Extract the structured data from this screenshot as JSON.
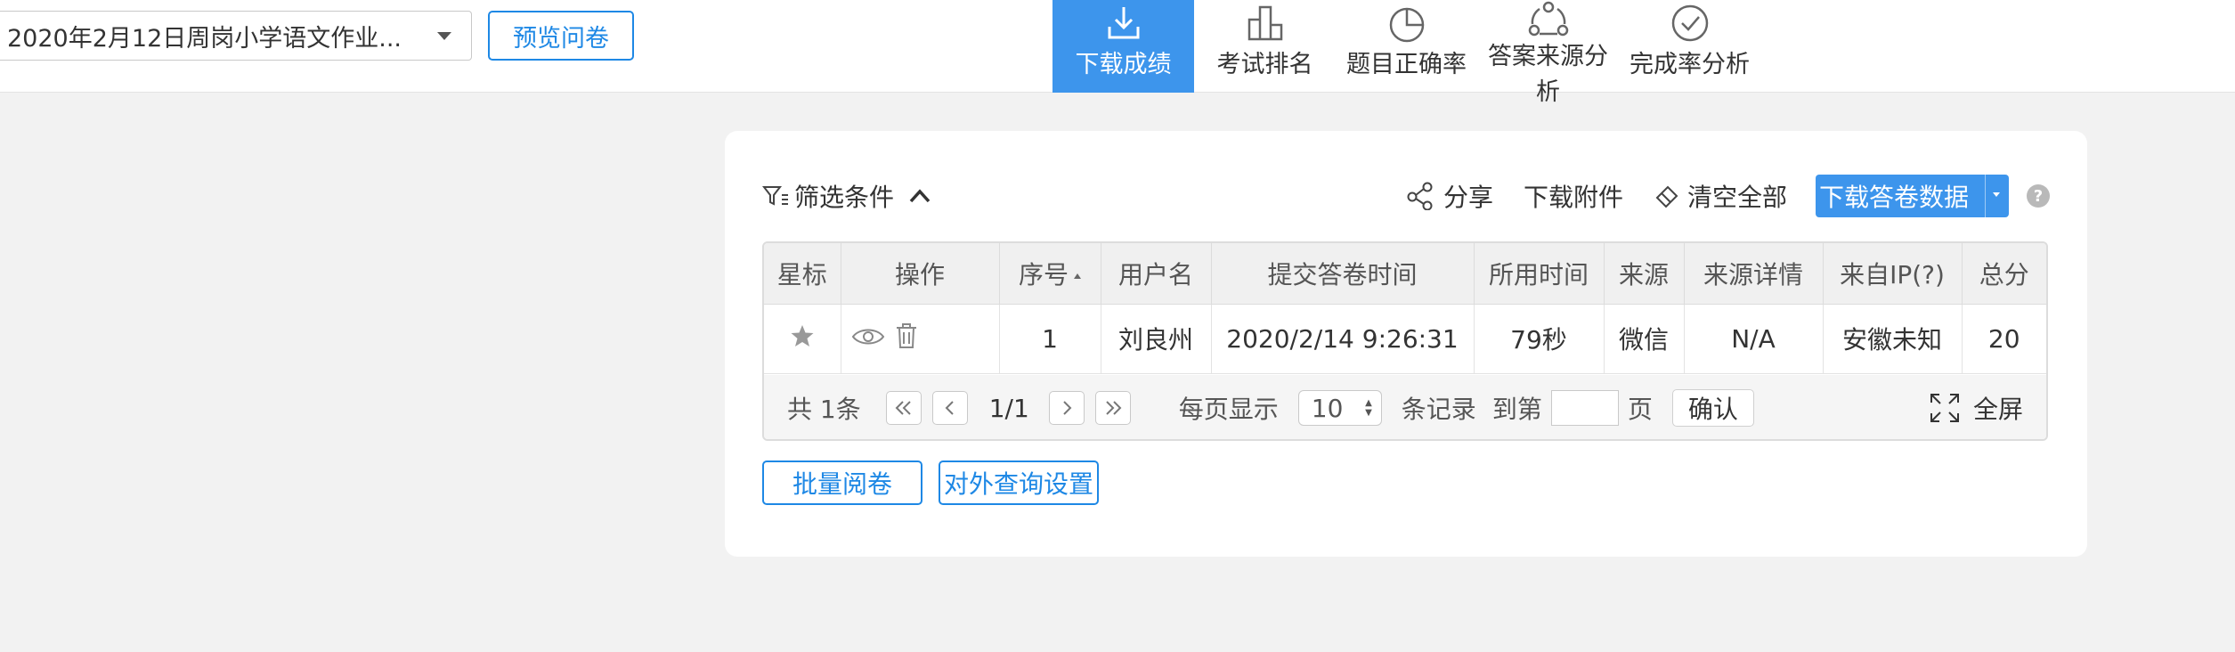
{
  "topbar": {
    "survey_select_value": "2020年2月12日周岗小学语文作业...",
    "preview_button": "预览问卷",
    "tabs": [
      {
        "label": "下载成绩",
        "icon": "download-icon",
        "active": true
      },
      {
        "label": "考试排名",
        "icon": "ranking-icon",
        "active": false
      },
      {
        "label": "题目正确率",
        "icon": "pie-chart-icon",
        "active": false
      },
      {
        "label": "答案来源分析",
        "icon": "share-nodes-icon",
        "active": false
      },
      {
        "label": "完成率分析",
        "icon": "check-circle-icon",
        "active": false
      }
    ]
  },
  "toolbar": {
    "filter_label": "筛选条件",
    "share_label": "分享",
    "download_attachments_label": "下载附件",
    "clear_all_label": "清空全部",
    "download_data_label": "下载答卷数据"
  },
  "table": {
    "headers": [
      "星标",
      "操作",
      "序号",
      "用户名",
      "提交答卷时间",
      "所用时间",
      "来源",
      "来源详情",
      "来自IP(?)",
      "总分"
    ],
    "rows": [
      {
        "seq": "1",
        "username": "刘良州",
        "submit_time": "2020/2/14 9:26:31",
        "duration": "79秒",
        "source": "微信",
        "source_detail": "N/A",
        "ip": "安徽未知",
        "score": "20"
      }
    ]
  },
  "pager": {
    "total": "共 1条",
    "page_info": "1/1",
    "per_page_label": "每页显示",
    "per_page_value": "10",
    "records_label": "条记录",
    "goto_label": "到第",
    "page_label": "页",
    "confirm_label": "确认",
    "fullscreen_label": "全屏"
  },
  "actions": {
    "batch_review": "批量阅卷",
    "external_query": "对外查询设置"
  },
  "colors": {
    "accent": "#3d95ec",
    "link_blue": "#1e88e5"
  }
}
